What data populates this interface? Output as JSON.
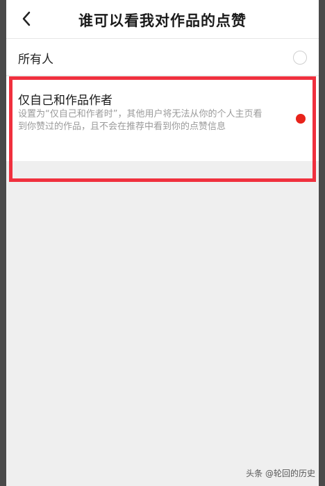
{
  "header": {
    "title": "谁可以看我对作品的点赞",
    "back_icon": "chevron-left-icon"
  },
  "options": [
    {
      "label": "所有人",
      "selected": false
    },
    {
      "label": "仅自己和作品作者",
      "description": "设置为“仅自己和作者时”，其他用户将无法从你的个人主页看到你赞过的作品，且不会在推荐中看到你的点赞信息",
      "selected": true
    }
  ],
  "colors": {
    "accent": "#e8231b",
    "highlight_border": "#f0303e",
    "background": "#efefef"
  },
  "watermark": "头条 @轮回的历史"
}
